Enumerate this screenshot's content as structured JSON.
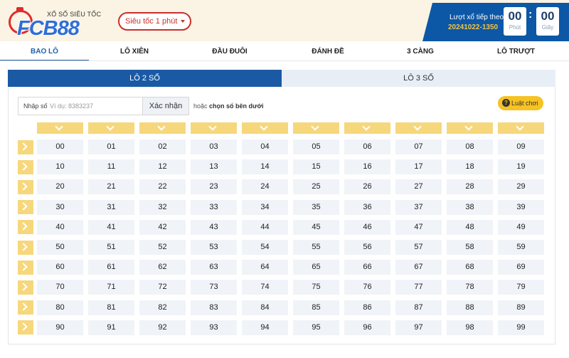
{
  "header": {
    "logo_title": "XỔ SỐ SIÊU TỐC",
    "logo_word": "FCB88",
    "speed_select": "Siêu tốc 1 phút",
    "next_label": "Lượt xổ tiếp theo",
    "next_code": "20241022-1350",
    "timer": {
      "minutes": "00",
      "minutes_unit": "Phút",
      "seconds": "00",
      "seconds_unit": "Giây"
    }
  },
  "tabs": [
    "BAO LÔ",
    "LÔ XIÊN",
    "ĐẦU ĐUÔI",
    "ĐÁNH ĐỀ",
    "3 CÀNG",
    "LÔ TRƯỢT"
  ],
  "active_tab": "BAO LÔ",
  "subtabs": {
    "active": "LÔ 2 SỐ",
    "inactive": "LÔ 3 SỐ"
  },
  "input": {
    "label": "Nhập số",
    "placeholder": "Ví dụ: 8383237",
    "value": "",
    "confirm_label": "Xác nhận",
    "or_text": "hoặc",
    "choose_text": "chọn số bên dưới"
  },
  "rules_button": {
    "label": "Luật chơi",
    "icon": "question-icon"
  },
  "grid": {
    "rows": [
      [
        "00",
        "01",
        "02",
        "03",
        "04",
        "05",
        "06",
        "07",
        "08",
        "09"
      ],
      [
        "10",
        "11",
        "12",
        "13",
        "14",
        "15",
        "16",
        "17",
        "18",
        "19"
      ],
      [
        "20",
        "21",
        "22",
        "23",
        "24",
        "25",
        "26",
        "27",
        "28",
        "29"
      ],
      [
        "30",
        "31",
        "32",
        "33",
        "34",
        "35",
        "36",
        "37",
        "38",
        "39"
      ],
      [
        "40",
        "41",
        "42",
        "43",
        "44",
        "45",
        "46",
        "47",
        "48",
        "49"
      ],
      [
        "50",
        "51",
        "52",
        "53",
        "54",
        "55",
        "56",
        "57",
        "58",
        "59"
      ],
      [
        "60",
        "61",
        "62",
        "63",
        "64",
        "65",
        "66",
        "67",
        "68",
        "69"
      ],
      [
        "70",
        "71",
        "72",
        "73",
        "74",
        "75",
        "76",
        "77",
        "78",
        "79"
      ],
      [
        "80",
        "81",
        "82",
        "83",
        "84",
        "85",
        "86",
        "87",
        "88",
        "89"
      ],
      [
        "90",
        "91",
        "92",
        "93",
        "94",
        "95",
        "96",
        "97",
        "98",
        "99"
      ]
    ]
  },
  "colors": {
    "primary": "#1a5aa5",
    "accent": "#f7d77c",
    "header_bg": "#fbf3e3",
    "select_red": "#c9302c",
    "code_yellow": "#f4c542"
  }
}
